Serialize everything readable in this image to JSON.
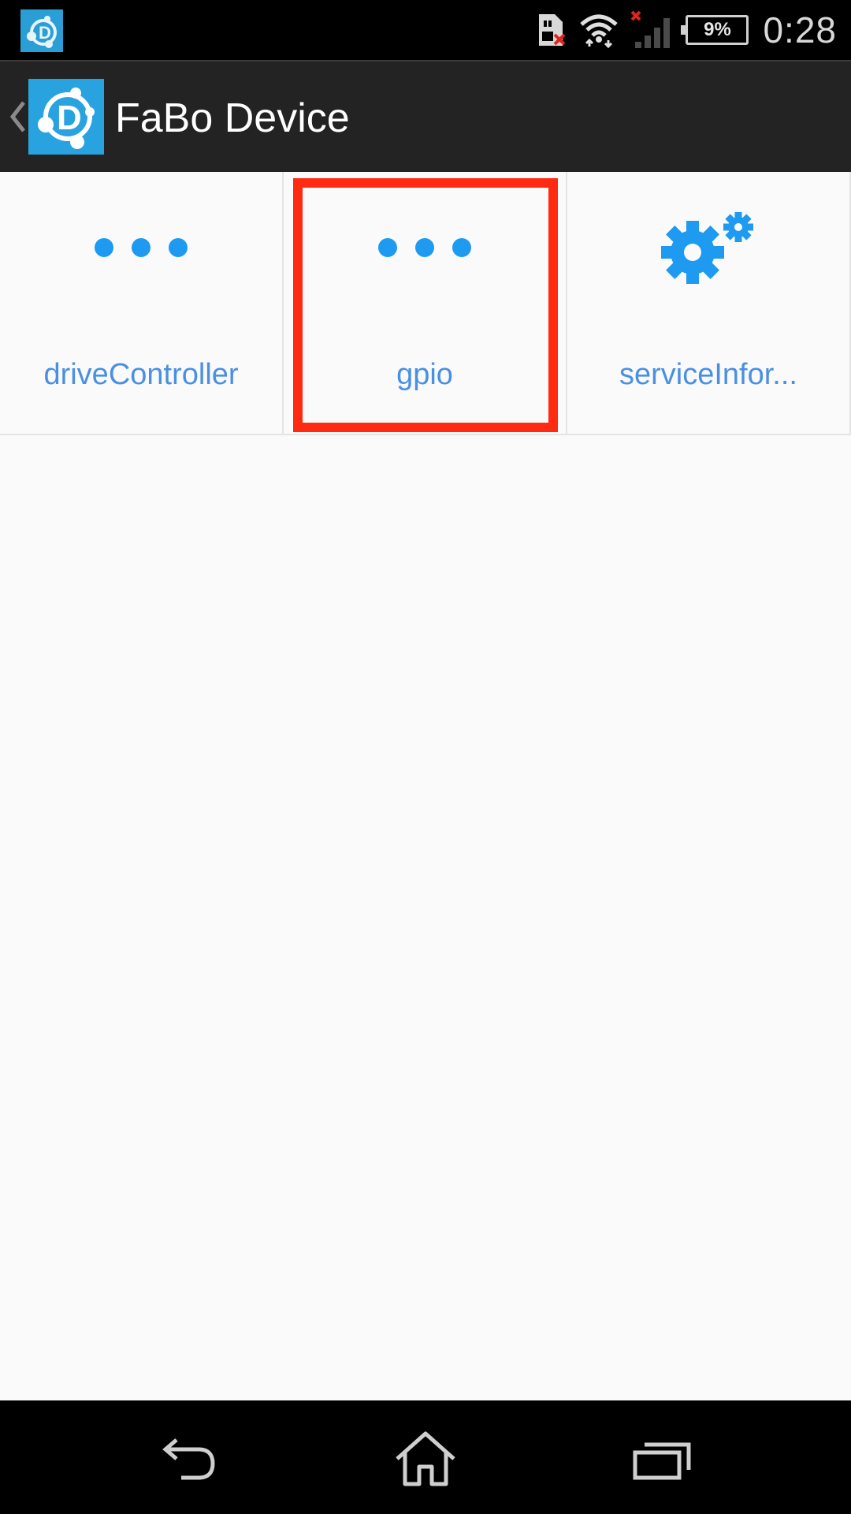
{
  "status_bar": {
    "time": "0:28",
    "battery_percent": "9%",
    "icons": [
      "app-notification-icon",
      "sim-missing-icon",
      "wifi-icon",
      "signal-no-service-icon",
      "battery-icon"
    ]
  },
  "action_bar": {
    "title": "FaBo Device",
    "icons": [
      "up-chevron-icon",
      "app-logo-icon"
    ]
  },
  "grid": {
    "tiles": [
      {
        "label": "driveController",
        "icon": "dots-icon"
      },
      {
        "label": "gpio",
        "icon": "dots-icon"
      },
      {
        "label": "serviceInfor...",
        "icon": "gears-icon"
      }
    ],
    "highlighted_tile": "gpio"
  },
  "nav_bar": {
    "buttons": [
      "back-icon",
      "home-icon",
      "recent-apps-icon"
    ]
  },
  "colors": {
    "accent": "#1e9bf0",
    "label": "#4a90e2",
    "highlight": "#ff2a12",
    "action_bar": "#232323",
    "background": "#fafafa"
  }
}
